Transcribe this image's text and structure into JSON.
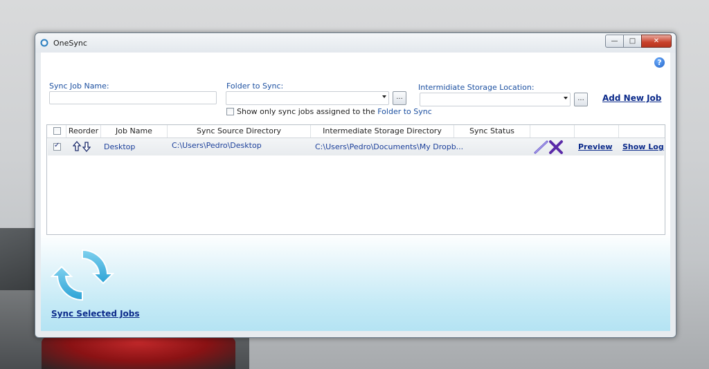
{
  "window": {
    "title": "OneSync"
  },
  "help": {
    "label": "?"
  },
  "form": {
    "job_name_label": "Sync Job Name:",
    "job_name_value": "",
    "folder_label": "Folder to Sync:",
    "folder_value": "",
    "folder_browse": "...",
    "storage_label": "Intermidiate Storage Location:",
    "storage_value": "",
    "storage_browse": "...",
    "filter_checkbox_prefix": "Show only sync jobs assigned to the ",
    "filter_checkbox_link": "Folder to Sync",
    "add_job": "Add New Job"
  },
  "grid": {
    "columns": [
      "Reorder",
      "Job Name",
      "Sync Source Directory",
      "Intermediate Storage Directory",
      "Sync Status"
    ],
    "rows": [
      {
        "checked": true,
        "job_name": "Desktop",
        "source": "C:\\Users\\Pedro\\Desktop",
        "storage": "C:\\Users\\Pedro\\Documents\\My Dropb...",
        "status": "",
        "preview": "Preview",
        "show_log": "Show Log"
      }
    ]
  },
  "footer": {
    "sync_label": "Sync Selected Jobs"
  },
  "colors": {
    "accent": "#1b4fa0",
    "link": "#0b2a8a",
    "sync_gradient_end": "#b4e3f3",
    "delete_x": "#5a2aa8"
  }
}
